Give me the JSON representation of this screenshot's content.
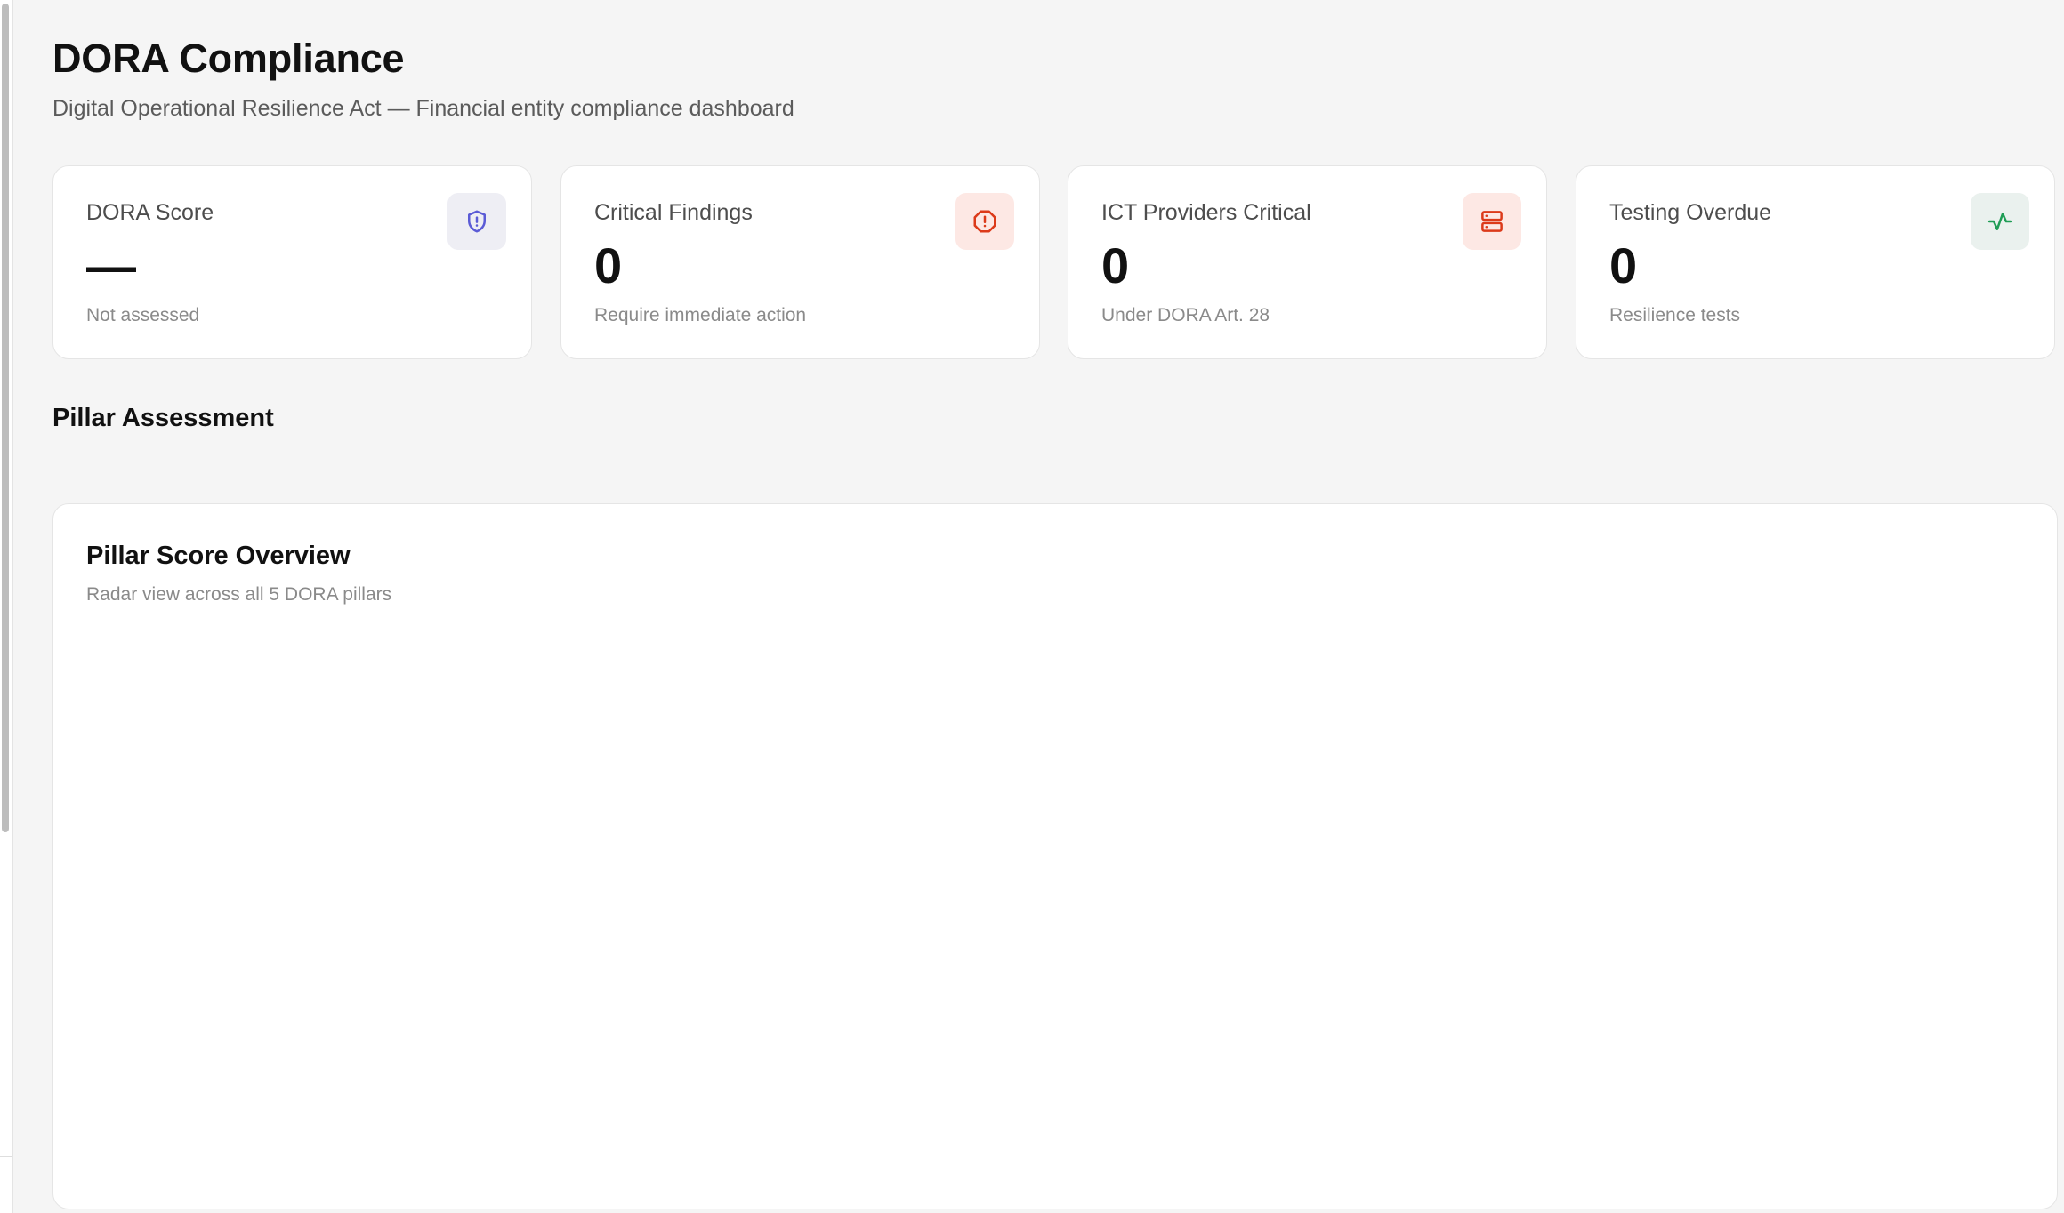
{
  "header": {
    "title": "DORA Compliance",
    "subtitle": "Digital Operational Resilience Act — Financial entity compliance dashboard"
  },
  "stats": [
    {
      "label": "DORA Score",
      "value": "—",
      "caption": "Not assessed",
      "icon": "shield-alert-icon",
      "icon_color": "#5b5bd6",
      "icon_bg": "#eeeef4"
    },
    {
      "label": "Critical Findings",
      "value": "0",
      "caption": "Require immediate action",
      "icon": "octagon-alert-icon",
      "icon_color": "#dc3a1a",
      "icon_bg": "#fde8e4"
    },
    {
      "label": "ICT Providers Critical",
      "value": "0",
      "caption": "Under DORA Art. 28",
      "icon": "server-icon",
      "icon_color": "#dc3a1a",
      "icon_bg": "#fde8e4"
    },
    {
      "label": "Testing Overdue",
      "value": "0",
      "caption": "Resilience tests",
      "icon": "activity-icon",
      "icon_color": "#1f9d55",
      "icon_bg": "#eaf1ee"
    }
  ],
  "pillar_section": {
    "heading": "Pillar Assessment"
  },
  "chart_card": {
    "title": "Pillar Score Overview",
    "subtitle": "Radar view across all 5 DORA pillars"
  }
}
